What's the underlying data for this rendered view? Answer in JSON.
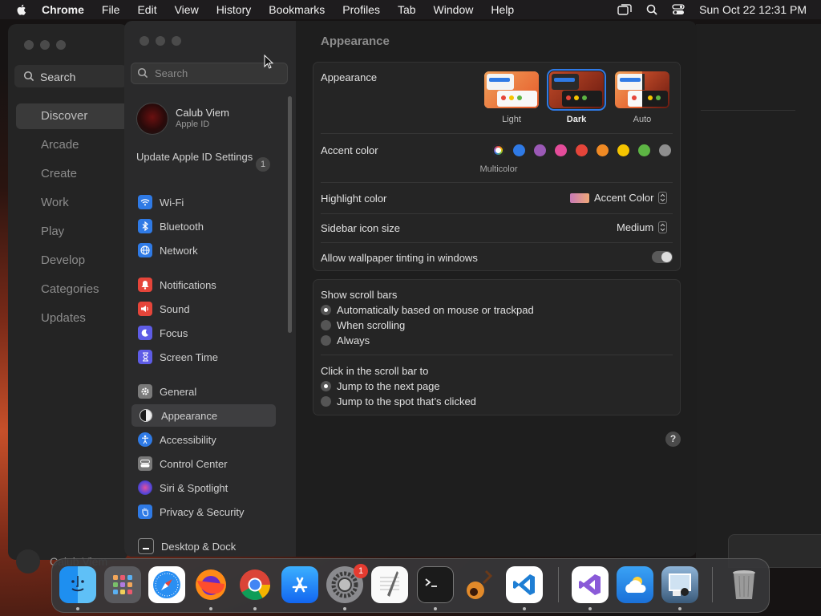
{
  "menubar": {
    "app": "Chrome",
    "items": [
      "File",
      "Edit",
      "View",
      "History",
      "Bookmarks",
      "Profiles",
      "Tab",
      "Window",
      "Help"
    ],
    "clock": "Sun Oct 22  12:31 PM"
  },
  "bg_app_store": {
    "search_placeholder": "Search",
    "nav": [
      "Discover",
      "Arcade",
      "Create",
      "Work",
      "Play",
      "Develop",
      "Categories",
      "Updates"
    ],
    "user": "Calub Viem"
  },
  "sidebar": {
    "search_placeholder": "Search",
    "account": {
      "name": "Calub Viem",
      "sub": "Apple ID"
    },
    "update": {
      "label": "Update Apple ID Settings",
      "badge": "1"
    },
    "items": [
      {
        "label": "Wi-Fi",
        "icon": "wifi-icon",
        "color": "#2f7ae5"
      },
      {
        "label": "Bluetooth",
        "icon": "bluetooth-icon",
        "color": "#2f7ae5"
      },
      {
        "label": "Network",
        "icon": "globe-icon",
        "color": "#2f7ae5"
      },
      {
        "label": "Notifications",
        "icon": "bell-icon",
        "color": "#e5453a"
      },
      {
        "label": "Sound",
        "icon": "speaker-icon",
        "color": "#e5453a"
      },
      {
        "label": "Focus",
        "icon": "moon-icon",
        "color": "#5e5ce6"
      },
      {
        "label": "Screen Time",
        "icon": "hourglass-icon",
        "color": "#5e5ce6"
      },
      {
        "label": "General",
        "icon": "gear-icon",
        "color": "#7a7a7a"
      },
      {
        "label": "Appearance",
        "icon": "appearance-icon",
        "color": "#1a1a1a"
      },
      {
        "label": "Accessibility",
        "icon": "accessibility-icon",
        "color": "#2f7ae5"
      },
      {
        "label": "Control Center",
        "icon": "control-center-icon",
        "color": "#7a7a7a"
      },
      {
        "label": "Siri & Spotlight",
        "icon": "siri-icon",
        "color": "#c2478f"
      },
      {
        "label": "Privacy & Security",
        "icon": "hand-icon",
        "color": "#2f7ae5"
      },
      {
        "label": "Desktop & Dock",
        "icon": "dock-icon",
        "color": "#2a2a2a"
      }
    ],
    "selected": "Appearance"
  },
  "main": {
    "title": "Appearance",
    "appearance": {
      "label": "Appearance",
      "options": [
        "Light",
        "Dark",
        "Auto"
      ],
      "selected": "Dark"
    },
    "accent": {
      "label": "Accent color",
      "caption": "Multicolor",
      "colors": [
        "#6b5bd6",
        "#2f7ae5",
        "#9b59b6",
        "#e44c9a",
        "#e5453a",
        "#f08a24",
        "#f5c400",
        "#5db544",
        "#8e8e8e"
      ]
    },
    "highlight": {
      "label": "Highlight color",
      "value": "Accent Color"
    },
    "sidebar_icon": {
      "label": "Sidebar icon size",
      "value": "Medium"
    },
    "tinting": {
      "label": "Allow wallpaper tinting in windows",
      "on": false
    },
    "scroll_bars": {
      "label": "Show scroll bars",
      "options": [
        "Automatically based on mouse or trackpad",
        "When scrolling",
        "Always"
      ],
      "selected": "Automatically based on mouse or trackpad"
    },
    "click_scroll": {
      "label": "Click in the scroll bar to",
      "options": [
        "Jump to the next page",
        "Jump to the spot that’s clicked"
      ],
      "selected": "Jump to the next page"
    },
    "help": "?"
  },
  "dock": {
    "apps": [
      "Finder",
      "Launchpad",
      "Safari",
      "Firefox",
      "Chrome",
      "App Store",
      "System Settings",
      "TextEdit",
      "Terminal",
      "GarageBand",
      "Visual Studio Code",
      "Visual Studio",
      "Weather",
      "Preview",
      "Trash"
    ],
    "badge": "1"
  }
}
